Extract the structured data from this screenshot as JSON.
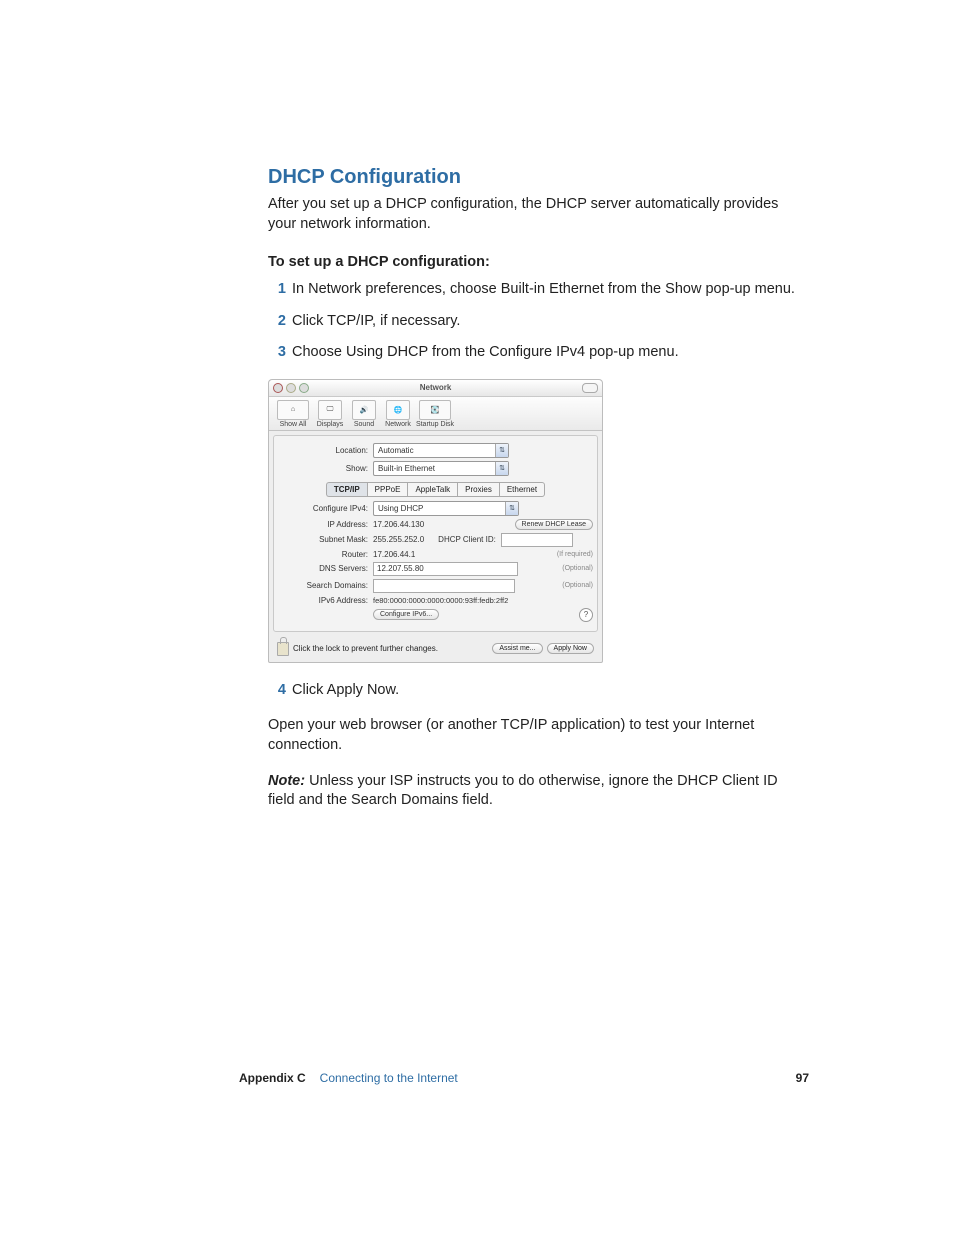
{
  "section": {
    "title": "DHCP Configuration",
    "intro": "After you set up a DHCP configuration, the DHCP server automatically provides your network information.",
    "subheading": "To set up a DHCP configuration:",
    "steps": [
      "In Network preferences, choose Built-in Ethernet from the Show pop-up menu.",
      "Click TCP/IP, if necessary.",
      "Choose Using DHCP from the Configure IPv4 pop-up menu."
    ],
    "step4": "Click Apply Now.",
    "para_after_4": "Open your web browser (or another TCP/IP application) to test your Internet connection.",
    "note_label": "Note:",
    "note_body": "Unless your ISP instructs you to do otherwise, ignore the DHCP Client ID field and the Search Domains field."
  },
  "win": {
    "title": "Network",
    "toolbar": {
      "show_all": "Show All",
      "displays": "Displays",
      "sound": "Sound",
      "network": "Network",
      "startup_disk": "Startup Disk"
    },
    "location_label": "Location:",
    "location_value": "Automatic",
    "show_label": "Show:",
    "show_value": "Built-in Ethernet",
    "tabs": [
      "TCP/IP",
      "PPPoE",
      "AppleTalk",
      "Proxies",
      "Ethernet"
    ],
    "configure_label": "Configure IPv4:",
    "configure_value": "Using DHCP",
    "ip_label": "IP Address:",
    "ip_value": "17.206.44.130",
    "renew_btn": "Renew DHCP Lease",
    "subnet_label": "Subnet Mask:",
    "subnet_value": "255.255.252.0",
    "clientid_label": "DHCP Client ID:",
    "clientid_hint": "(If required)",
    "router_label": "Router:",
    "router_value": "17.206.44.1",
    "dns_label": "DNS Servers:",
    "dns_value": "12.207.55.80",
    "dns_hint": "(Optional)",
    "search_label": "Search Domains:",
    "search_hint": "(Optional)",
    "ipv6addr_label": "IPv6 Address:",
    "ipv6addr_value": "fe80:0000:0000:0000:0000:93ff:fedb:2ff2",
    "ipv6btn": "Configure IPv6...",
    "lock_text": "Click the lock to prevent further changes.",
    "assist_btn": "Assist me...",
    "apply_btn": "Apply Now"
  },
  "footer": {
    "appendix": "Appendix C",
    "chapter": "Connecting to the Internet",
    "page_num": "97"
  }
}
